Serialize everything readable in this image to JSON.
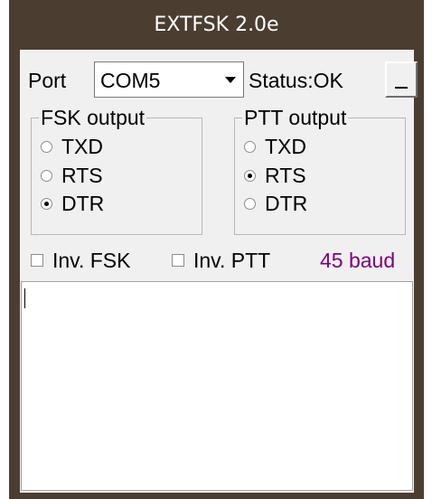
{
  "window": {
    "title": "EXTFSK 2.0e"
  },
  "port": {
    "label": "Port",
    "selected": "COM5"
  },
  "status": {
    "text": "Status:OK"
  },
  "minimize_button": {
    "icon": "minimize-icon"
  },
  "fsk_output": {
    "title": "FSK output",
    "options": [
      {
        "label": "TXD",
        "checked": false
      },
      {
        "label": "RTS",
        "checked": false
      },
      {
        "label": "DTR",
        "checked": true
      }
    ]
  },
  "ptt_output": {
    "title": "PTT output",
    "options": [
      {
        "label": "TXD",
        "checked": false
      },
      {
        "label": "RTS",
        "checked": true
      },
      {
        "label": "DTR",
        "checked": false
      }
    ]
  },
  "inv_fsk": {
    "label": "Inv. FSK",
    "checked": false
  },
  "inv_ptt": {
    "label": "Inv. PTT",
    "checked": false
  },
  "baud": {
    "text": "45 baud",
    "color": "#800080"
  },
  "text_area": {
    "value": ""
  },
  "colors": {
    "title_bar": "#4c3d31",
    "client_bg": "#f0f0f0"
  }
}
